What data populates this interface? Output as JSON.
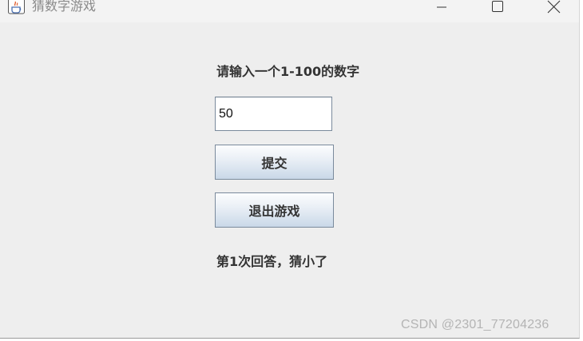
{
  "window": {
    "title": "猜数字游戏",
    "app_icon": "java-cup-icon",
    "controls": {
      "minimize_icon": "minimize-icon",
      "maximize_icon": "maximize-icon",
      "close_icon": "close-icon"
    }
  },
  "form": {
    "prompt": "请输入一个1-100的数字",
    "input_value": "50",
    "submit_label": "提交",
    "exit_label": "退出游戏",
    "result_text": "第1次回答，猜小了"
  },
  "watermark": "CSDN @2301_77204236",
  "colors": {
    "window_bg": "#eeeeee",
    "titlebar_bg": "#f3f3f3",
    "button_gradient_top": "#fcfdfe",
    "button_gradient_bottom": "#c9d8e8",
    "button_border": "#7a8a9c",
    "text": "#333333"
  }
}
